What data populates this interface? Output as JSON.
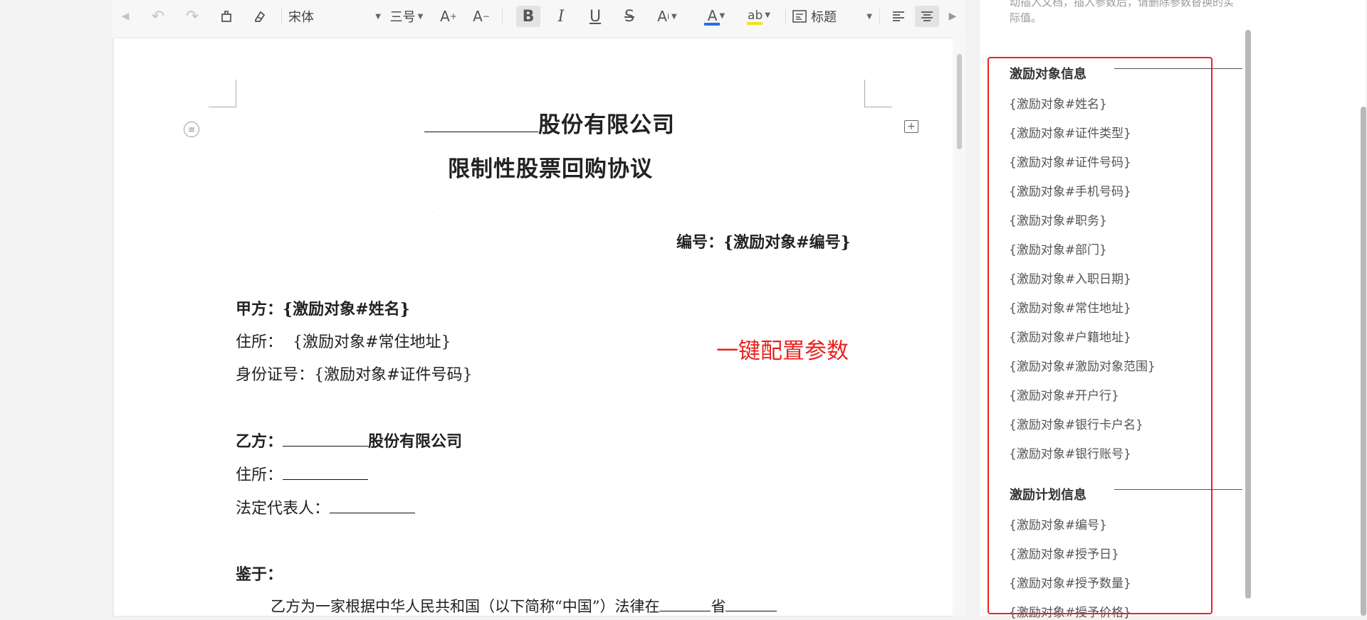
{
  "toolbar": {
    "font_name": "宋体",
    "font_size": "三号",
    "style_label": "标题"
  },
  "document": {
    "title_line1_suffix": "股份有限公司",
    "title_line2": "限制性股票回购协议",
    "number_label": "编号：",
    "number_value": "{激励对象#编号}",
    "party_a_label": "甲方：",
    "party_a_value": "{激励对象#姓名}",
    "address_a_label": "住所：",
    "address_a_value": "{激励对象#常住地址}",
    "id_label": "身份证号：",
    "id_value": "{激励对象#证件号码}",
    "party_b_label": "乙方：",
    "party_b_suffix": "股份有限公司",
    "address_b_label": "住所：",
    "rep_label": "法定代表人：",
    "whereas_label": "鉴于：",
    "para1_text": "乙方为一家根据中华人民共和国（以下简称“中国”）法律在",
    "para1_suffix": "省"
  },
  "annotation": "一键配置参数",
  "panel": {
    "note": "动插入文档，插入参数后，请删除参数替换的实际值。",
    "groups": [
      {
        "title": "激励对象信息",
        "items": [
          "{激励对象#姓名}",
          "{激励对象#证件类型}",
          "{激励对象#证件号码}",
          "{激励对象#手机号码}",
          "{激励对象#职务}",
          "{激励对象#部门}",
          "{激励对象#入职日期}",
          "{激励对象#常住地址}",
          "{激励对象#户籍地址}",
          "{激励对象#激励对象范围}",
          "{激励对象#开户行}",
          "{激励对象#银行卡户名}",
          "{激励对象#银行账号}"
        ]
      },
      {
        "title": "激励计划信息",
        "items": [
          "{激励对象#编号}",
          "{激励对象#授予日}",
          "{激励对象#授予数量}",
          "{激励对象#授予价格}"
        ]
      }
    ]
  },
  "colors": {
    "accent_red": "#e8231d",
    "font_color_bar": "#2d6ee0",
    "highlight_bar": "#f2e21c"
  }
}
